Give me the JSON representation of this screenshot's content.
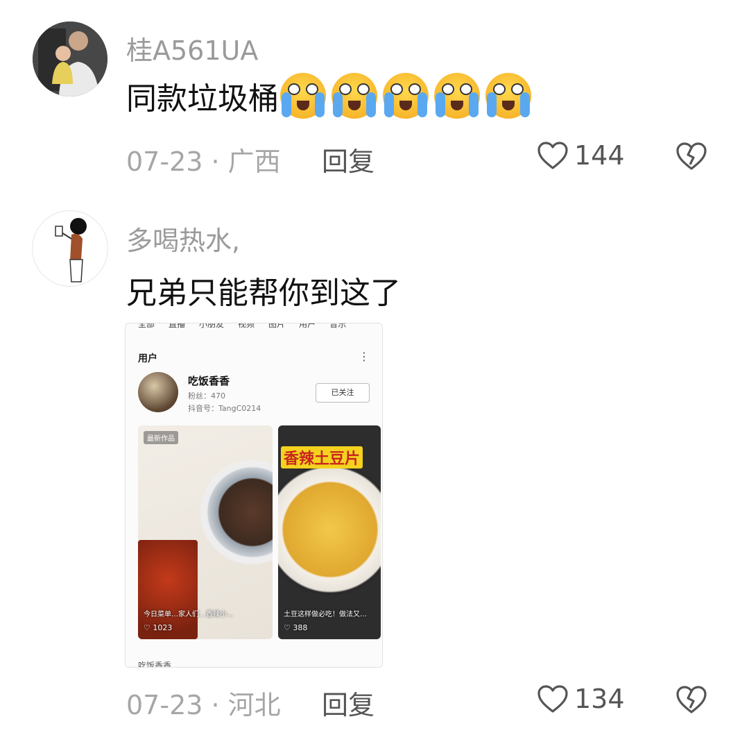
{
  "comments": [
    {
      "username": "桂A561UA",
      "text": "同款垃圾桶",
      "emojis": [
        "crying-face-emoji",
        "crying-face-emoji",
        "crying-face-emoji",
        "crying-face-emoji",
        "crying-face-emoji"
      ],
      "meta": "07-23 · 广西",
      "reply_label": "回复",
      "likes": "144"
    },
    {
      "username": "多喝热水,",
      "text": "兄弟只能帮你到这了",
      "meta": "07-23 · 河北",
      "reply_label": "回复",
      "likes": "134",
      "attached_screenshot": {
        "tabs": [
          "全部",
          "直播",
          "小朋友",
          "视频",
          "图片",
          "用户",
          "音乐"
        ],
        "section_title": "用户",
        "user": {
          "name": "吃饭香香",
          "fans": "粉丝：470",
          "id": "抖音号：TangC0214",
          "follow_label": "已关注"
        },
        "cards": [
          {
            "badge": "最新作品",
            "caption": "今日菜单…家人们…香辣小…",
            "likes": "1023"
          },
          {
            "title": "香辣土豆片",
            "caption": "土豆这样做必吃！做法又…",
            "likes": "388"
          }
        ],
        "bottom_peek": "吃饭香香"
      }
    }
  ]
}
